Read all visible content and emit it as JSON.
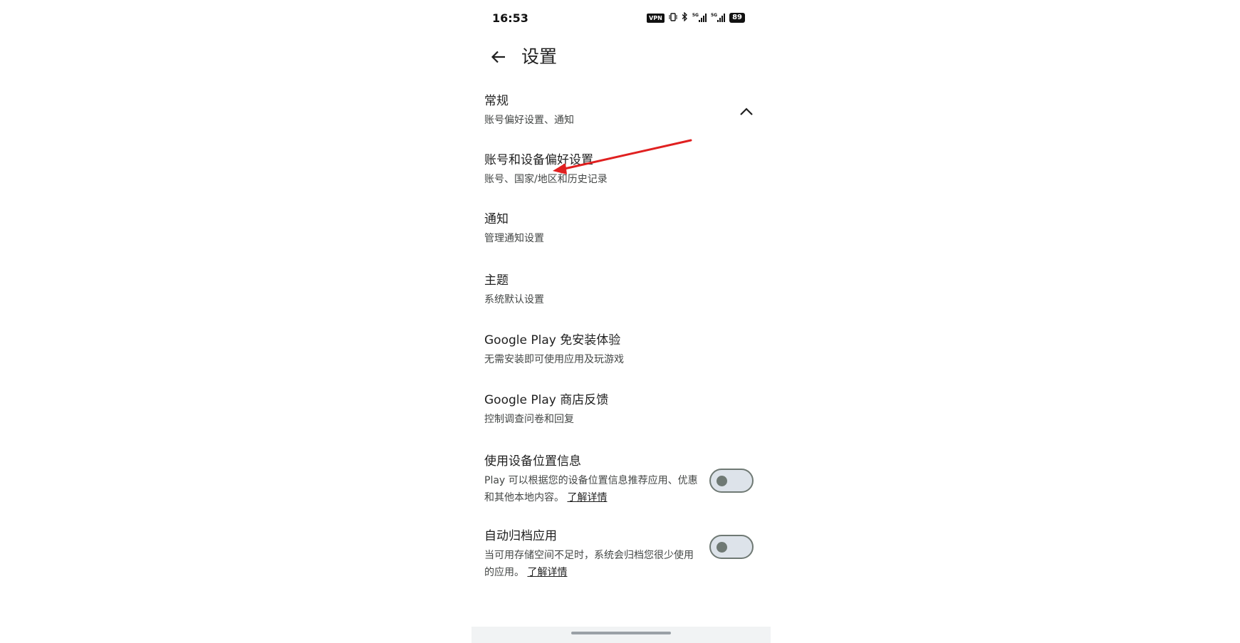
{
  "status_bar": {
    "time": "16:53",
    "vpn_label": "VPN",
    "battery_level": "89",
    "network_label_1": "5G",
    "network_label_2": "5G"
  },
  "appbar": {
    "title": "设置",
    "back_icon": "arrow-back-icon"
  },
  "section": {
    "title": "常规",
    "subtitle": "账号偏好设置、通知",
    "expanded": true
  },
  "items": [
    {
      "title": "账号和设备偏好设置",
      "subtitle": "账号、国家/地区和历史记录"
    },
    {
      "title": "通知",
      "subtitle": "管理通知设置"
    },
    {
      "title": "主题",
      "subtitle": "系统默认设置"
    },
    {
      "title": "Google Play 免安装体验",
      "subtitle": "无需安装即可使用应用及玩游戏"
    },
    {
      "title": "Google Play 商店反馈",
      "subtitle": "控制调查问卷和回复"
    }
  ],
  "toggle_items": [
    {
      "title": "使用设备位置信息",
      "subtitle": "Play 可以根据您的设备位置信息推荐应用、优惠和其他本地内容。",
      "learn_more": "了解详情",
      "enabled": false
    },
    {
      "title": "自动归档应用",
      "subtitle": "当可用存储空间不足时，系统会归档您很少使用的应用。",
      "learn_more": "了解详情",
      "enabled": false
    }
  ],
  "colors": {
    "annotation_arrow": "#e02020",
    "toggle_track": "#dde3ea",
    "toggle_outline": "#6f7974"
  }
}
